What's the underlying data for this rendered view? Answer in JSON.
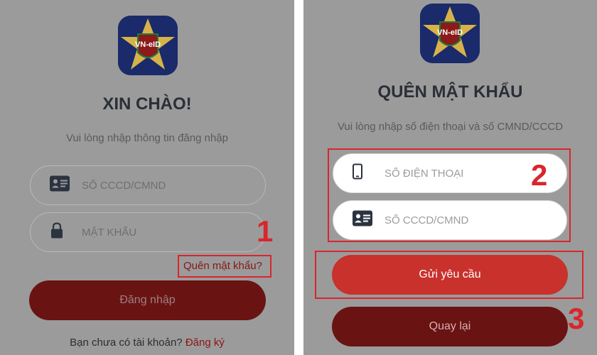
{
  "left": {
    "title": "XIN CHÀO!",
    "subtitle": "Vui lòng nhập thông tin đăng nhập",
    "id_placeholder": "SỐ CCCD/CMND",
    "password_placeholder": "MẬT KHẨU",
    "forgot_label": "Quên mật khẩu?",
    "login_label": "Đăng nhập",
    "signup_prompt": "Bạn chưa có tài khoản?",
    "signup_link": "Đăng ký",
    "step": "1"
  },
  "right": {
    "title": "QUÊN MẬT KHẨU",
    "subtitle": "Vui lòng nhập số điện thoại và số CMND/CCCD",
    "phone_placeholder": "SỐ ĐIỆN THOẠI",
    "id_placeholder": "SỐ CCCD/CMND",
    "submit_label": "Gửi yêu cầu",
    "back_label": "Quay lại",
    "step_fields": "2",
    "step_submit": "3"
  },
  "logo": {
    "text": "VN-eID"
  },
  "colors": {
    "accent": "#c8312c",
    "annotation": "#d8262c",
    "dark_red": "#6a1313"
  },
  "icons": {
    "id_card": "id-card-icon",
    "lock": "lock-icon",
    "phone": "phone-icon"
  }
}
